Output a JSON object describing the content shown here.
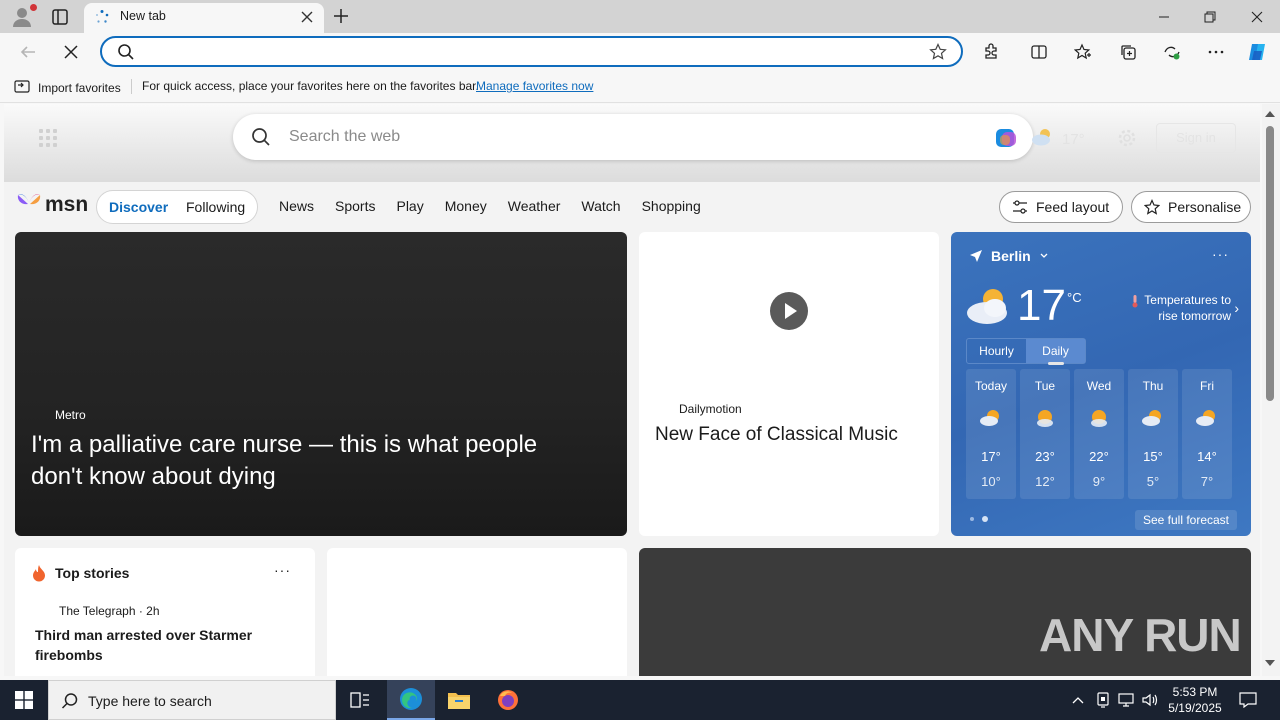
{
  "browser": {
    "tab_title": "New tab",
    "address_value": "",
    "favorites_bar": {
      "import_label": "Import favorites",
      "hint": "For quick access, place your favorites here on the favorites bar.",
      "manage_link": "Manage favorites now"
    }
  },
  "newtab": {
    "search_placeholder": "Search the web",
    "hero_temp": "17°",
    "sign_in": "Sign in"
  },
  "msn": {
    "logo": "msn",
    "tabs": [
      "Discover",
      "Following"
    ],
    "nav": [
      "News",
      "Sports",
      "Play",
      "Money",
      "Weather",
      "Watch",
      "Shopping"
    ],
    "feed_layout": "Feed layout",
    "personalise": "Personalise"
  },
  "cards": {
    "hero": {
      "source": "Metro",
      "headline": "I'm a palliative care nurse — this is what people don't know about dying"
    },
    "video": {
      "source": "Dailymotion",
      "headline": "New Face of Classical Music"
    },
    "weather": {
      "location": "Berlin",
      "temp": "17",
      "unit": "°C",
      "message": "Temperatures to rise tomorrow",
      "toggle": [
        "Hourly",
        "Daily"
      ],
      "days": [
        {
          "name": "Today",
          "hi": "17°",
          "lo": "10°"
        },
        {
          "name": "Tue",
          "hi": "23°",
          "lo": "12°"
        },
        {
          "name": "Wed",
          "hi": "22°",
          "lo": "9°"
        },
        {
          "name": "Thu",
          "hi": "15°",
          "lo": "5°"
        },
        {
          "name": "Fri",
          "hi": "14°",
          "lo": "7°"
        }
      ],
      "see_full": "See full forecast"
    },
    "top_stories": {
      "title": "Top stories",
      "source": "The Telegraph · 2h",
      "headline": "Third man arrested over Starmer firebombs"
    },
    "watermark": "ANY RUN"
  },
  "taskbar": {
    "search_placeholder": "Type here to search",
    "time": "5:53 PM",
    "date": "5/19/2025"
  },
  "colors": {
    "accent": "#0f6cbd",
    "weather_bg": "#3367b3",
    "taskbar": "#1a2230"
  }
}
